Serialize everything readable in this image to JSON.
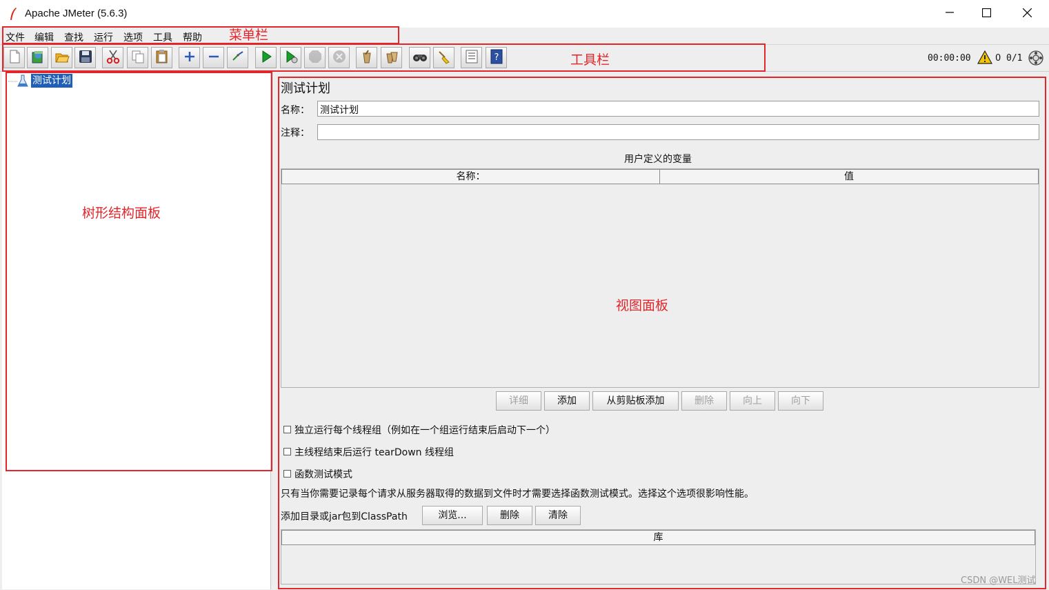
{
  "window": {
    "title": "Apache JMeter (5.6.3)",
    "minimize_icon": "minimize-icon",
    "maximize_icon": "maximize-icon",
    "close_icon": "close-icon"
  },
  "menubar": {
    "items": [
      "文件",
      "编辑",
      "查找",
      "运行",
      "选项",
      "工具",
      "帮助"
    ]
  },
  "toolbar": {
    "icons": [
      "new-icon",
      "templates-icon",
      "open-icon",
      "save-icon",
      "cut-icon",
      "copy-icon",
      "paste-icon",
      "expand-icon",
      "collapse-icon",
      "toggle-icon",
      "start-icon",
      "start-no-pause-icon",
      "stop-icon",
      "shutdown-icon",
      "clear-icon",
      "clear-all-icon",
      "search-icon",
      "reset-search-icon",
      "function-helper-icon",
      "help-icon"
    ],
    "timer": "00:00:00",
    "warning_count": "0",
    "active_threads": "0/1"
  },
  "tree": {
    "root_label": "测试计划"
  },
  "test_plan": {
    "heading": "测试计划",
    "name_label": "名称：",
    "name_value": "测试计划",
    "comment_label": "注释：",
    "comment_value": "",
    "variables_title": "用户定义的变量",
    "columns": [
      "名称：",
      "值"
    ],
    "buttons": {
      "detail": "详细",
      "add": "添加",
      "add_clipboard": "从剪贴板添加",
      "delete": "删除",
      "up": "向上",
      "down": "向下"
    },
    "checkbox_serialize": "独立运行每个线程组（例如在一个组运行结束后启动下一个）",
    "checkbox_teardown": "主线程结束后运行 tearDown 线程组",
    "checkbox_functional": "函数测试模式",
    "functional_note": "只有当你需要记录每个请求从服务器取得的数据到文件时才需要选择函数测试模式。选择这个选项很影响性能。",
    "classpath_label": "添加目录或jar包到ClassPath",
    "classpath_buttons": {
      "browse": "浏览...",
      "delete": "删除",
      "clear": "清除"
    },
    "library_header": "库"
  },
  "annotations": {
    "menubar": "菜单栏",
    "toolbar": "工具栏",
    "tree_panel": "树形结构面板",
    "view_panel": "视图面板",
    "color": "#e3252c"
  },
  "watermark": "CSDN @WEL测试"
}
